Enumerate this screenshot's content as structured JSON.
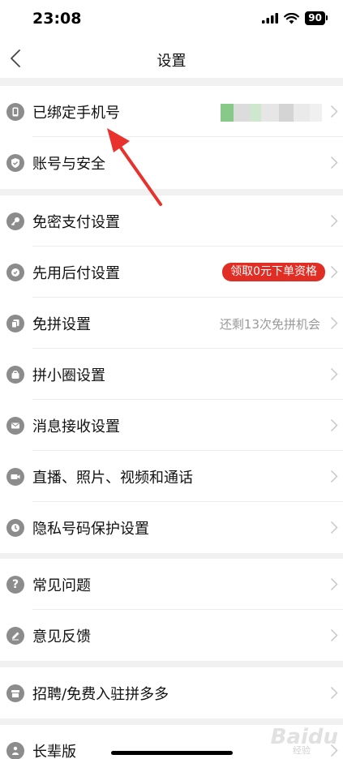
{
  "status_bar": {
    "time": "23:08",
    "battery": "90"
  },
  "nav": {
    "title": "设置"
  },
  "groups": [
    {
      "items": [
        {
          "label": "已绑定手机号",
          "icon": "phone-icon"
        },
        {
          "label": "账号与安全",
          "icon": "shield-check-icon"
        }
      ]
    },
    {
      "items": [
        {
          "label": "免密支付设置",
          "icon": "key-icon"
        },
        {
          "label": "先用后付设置",
          "icon": "gear-badge-icon",
          "badge": "领取0元下单资格"
        },
        {
          "label": "免拼设置",
          "icon": "copy-icon",
          "value": "还剩13次免拼机会"
        },
        {
          "label": "拼小圈设置",
          "icon": "bag-icon"
        },
        {
          "label": "消息接收设置",
          "icon": "envelope-icon"
        },
        {
          "label": "直播、照片、视频和通话",
          "icon": "video-camera-icon"
        },
        {
          "label": "隐私号码保护设置",
          "icon": "privacy-shield-icon"
        }
      ]
    },
    {
      "items": [
        {
          "label": "常见问题",
          "icon": "question-icon"
        },
        {
          "label": "意见反馈",
          "icon": "pencil-icon"
        }
      ]
    },
    {
      "items": [
        {
          "label": "招聘/免费入驻拼多多",
          "icon": "store-icon"
        }
      ]
    },
    {
      "items": [
        {
          "label": "长辈版",
          "icon": "elder-icon"
        }
      ]
    }
  ],
  "watermark": {
    "brand": "Baidu",
    "sub": "经验"
  },
  "colors": {
    "accent": "#e02e24",
    "icon_gray": "#8c8c8c",
    "arrow": "#e8322d"
  }
}
